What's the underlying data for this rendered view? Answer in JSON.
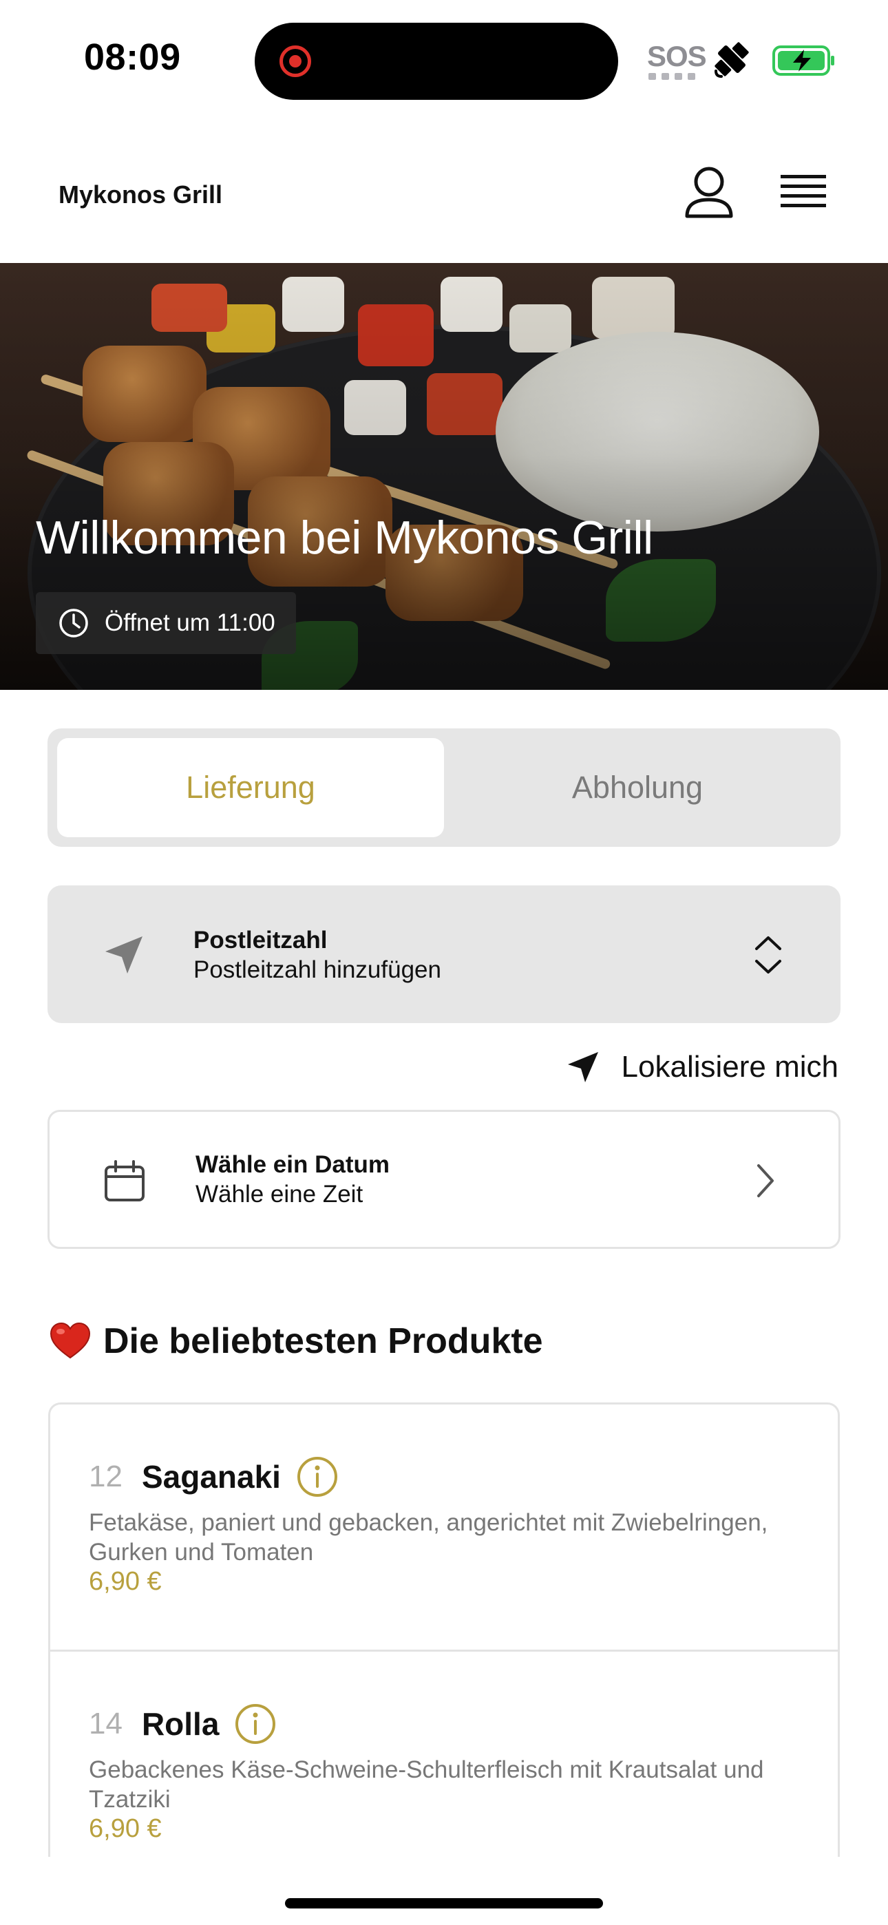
{
  "status_bar": {
    "time": "08:09",
    "sos": "SOS",
    "icons": [
      "record-indicator-icon",
      "satellite-icon",
      "battery-charging-icon"
    ],
    "battery_color": "#34c759"
  },
  "header": {
    "brand": "Mykonos Grill",
    "icons": [
      "user-icon",
      "hamburger-menu-icon"
    ]
  },
  "hero": {
    "title": "Willkommen bei Mykonos Grill",
    "hours": "Öffnet um 11:00",
    "icon": "clock-icon"
  },
  "order_mode": {
    "options": [
      {
        "label": "Lieferung",
        "active": true
      },
      {
        "label": "Abholung",
        "active": false
      }
    ],
    "accent_color": "#b8a03e"
  },
  "postcode": {
    "label": "Postleitzahl",
    "value": "Postleitzahl hinzufügen",
    "icon": "location-arrow-icon"
  },
  "locate": {
    "label": "Lokalisiere mich",
    "icon": "location-arrow-icon"
  },
  "schedule": {
    "label": "Wähle ein Datum",
    "sub": "Wähle eine Zeit",
    "icon": "calendar-icon"
  },
  "popular": {
    "title": "Die beliebtesten Produkte",
    "icon": "heart-icon",
    "products": [
      {
        "number": "12",
        "name": "Saganaki",
        "description": "Fetakäse, paniert und gebacken, angerichtet mit Zwiebelringen, Gurken und Tomaten",
        "price": "6,90 €"
      },
      {
        "number": "14",
        "name": "Rolla",
        "description": "Gebackenes Käse-Schweine-Schulterfleisch mit Krautsalat und Tzatziki",
        "price": "6,90 €"
      }
    ]
  }
}
